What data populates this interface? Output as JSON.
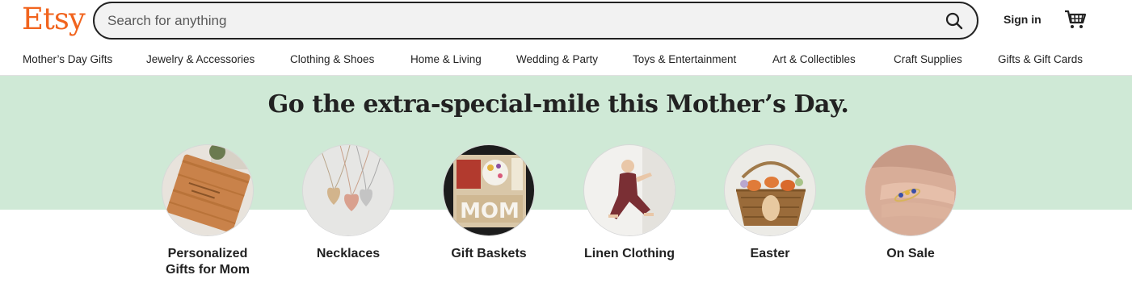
{
  "header": {
    "logo": "Etsy",
    "search_placeholder": "Search for anything",
    "signin_label": "Sign in"
  },
  "nav": {
    "items": [
      "Mother’s Day Gifts",
      "Jewelry & Accessories",
      "Clothing & Shoes",
      "Home & Living",
      "Wedding & Party",
      "Toys & Entertainment",
      "Art & Collectibles",
      "Craft Supplies",
      "Gifts & Gift Cards"
    ]
  },
  "hero": {
    "title": "Go the extra-special-mile this Mother’s Day.",
    "background_color": "#CFE9D6",
    "categories": [
      {
        "label": "Personalized Gifts for Mom"
      },
      {
        "label": "Necklaces"
      },
      {
        "label": "Gift Baskets"
      },
      {
        "label": "Linen Clothing"
      },
      {
        "label": "Easter"
      },
      {
        "label": "On Sale"
      }
    ]
  },
  "colors": {
    "brand": "#F1641E",
    "text": "#222222"
  },
  "icons": {
    "search": "search-icon",
    "cart": "cart-icon"
  }
}
